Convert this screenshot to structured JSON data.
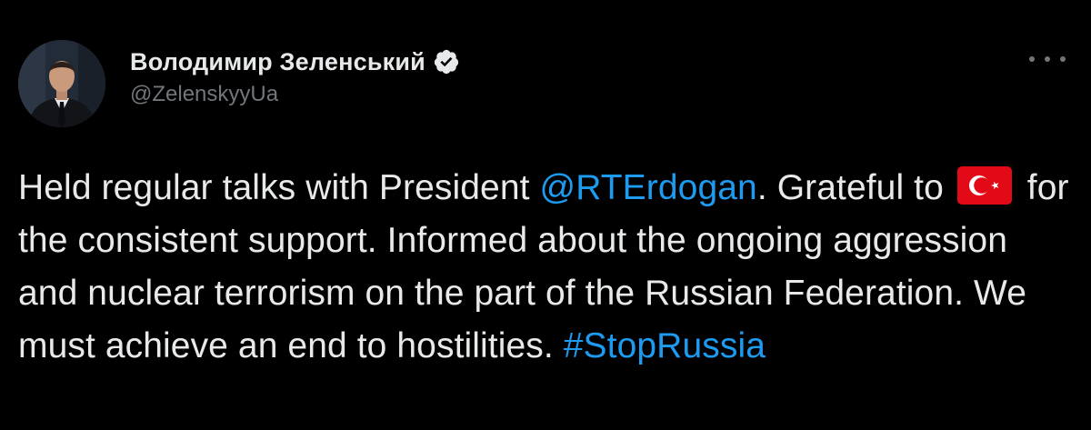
{
  "author": {
    "display_name": "Володимир Зеленський",
    "handle": "@ZelenskyyUa",
    "verified": true
  },
  "icons": {
    "verified": "verified-badge-icon",
    "more": "more-options-icon",
    "flag": "turkey-flag-emoji"
  },
  "tweet": {
    "text_1": "Held regular talks with President ",
    "mention": "@RTErdogan",
    "text_2": ". Grateful to ",
    "flag_emoji": "🇹🇷",
    "text_3": " for the consistent support. Informed about the ongoing aggression and nuclear terrorism on the part of the Russian Federation. We must achieve an end to hostilities.  ",
    "hashtag": "#StopRussia"
  },
  "colors": {
    "background": "#000000",
    "text": "#e7e9ea",
    "secondary": "#71767b",
    "link": "#1d9bf0",
    "flag_red": "#e30a17"
  }
}
